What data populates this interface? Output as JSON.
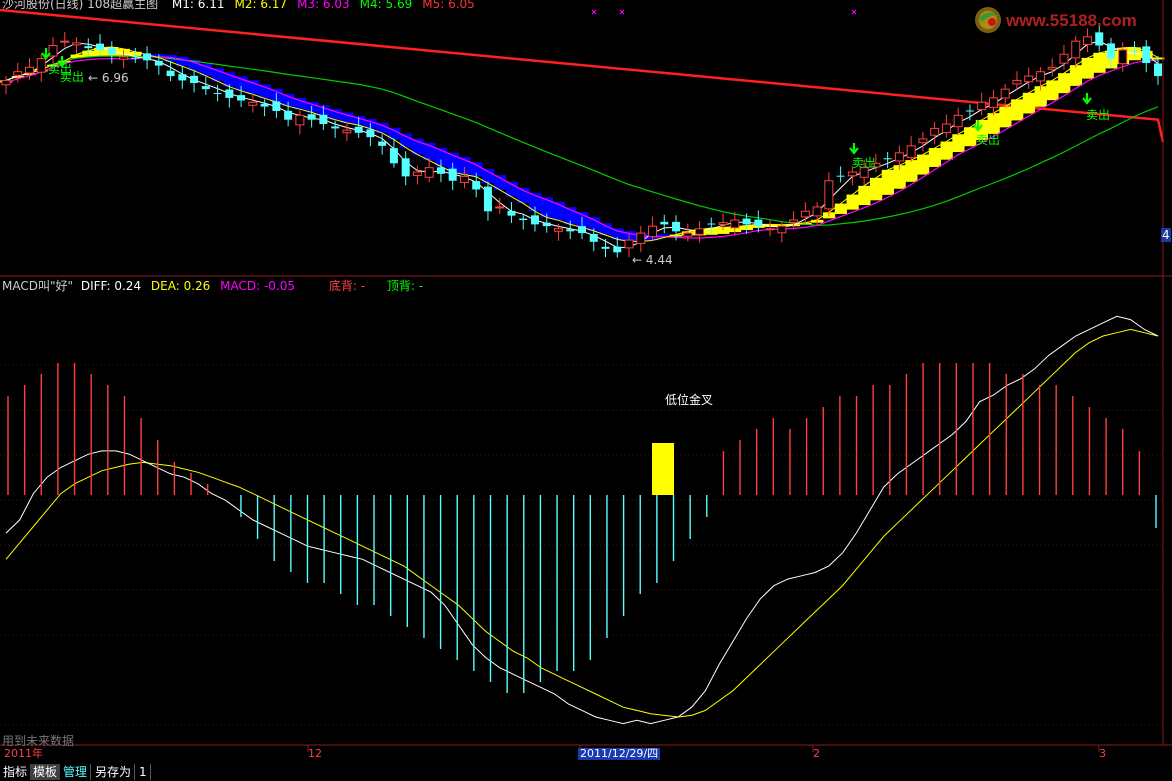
{
  "title_bar": {
    "name": "沙河股份(日线) 108超赢主图",
    "ma_labels": [
      {
        "text": "M1: 6.11",
        "color": "#ffffff"
      },
      {
        "text": "M2: 6.17",
        "color": "#ffff00"
      },
      {
        "text": "M3: 6.03",
        "color": "#ff00ff"
      },
      {
        "text": "M4: 5.69",
        "color": "#00ff00"
      },
      {
        "text": "M5: 6.05",
        "color": "#ff3030"
      }
    ]
  },
  "watermark": {
    "text": "www.55188.com"
  },
  "price_panel": {
    "high_label": "6.96",
    "low_label": "4.44",
    "sell_label": "卖出",
    "right_edge_label": "4"
  },
  "macd_panel": {
    "name": "MACD叫\"好\"",
    "diff_label": "DIFF: 0.24",
    "dea_label": "DEA: 0.26",
    "macd_label": "MACD: -0.05",
    "bottom_div": "底背: -",
    "top_div": "顶背: -",
    "annotation": "低位金叉",
    "bottom_note": "用到未来数据"
  },
  "x_axis": {
    "labels": [
      "2011年",
      "12",
      "2011/12/29/四",
      "2",
      "3"
    ]
  },
  "tabs": [
    "指标",
    "模板",
    "管理",
    "另存为",
    "1"
  ],
  "colors": {
    "up": "#ff4040",
    "down": "#54ffff",
    "diff": "#ffffff",
    "dea": "#ffff00",
    "macd_pos": "#ff4040",
    "macd_neg": "#54ffff",
    "ma_long": "#ff2020",
    "ma_mid": "#00cc00",
    "ma_short": "#ff00ff",
    "band_up": "#ffff00",
    "band_down": "#0000ff",
    "sell_arrow": "#00ff00"
  },
  "chart_data": [
    {
      "type": "candlestick",
      "title": "沙河股份(日线) 108超赢主图",
      "ylim": [
        4.3,
        7.2
      ],
      "annotations": [
        {
          "text": "6.96",
          "kind": "high"
        },
        {
          "text": "4.44",
          "kind": "low"
        }
      ],
      "series": [
        {
          "name": "M1",
          "last": 6.11
        },
        {
          "name": "M2",
          "last": 6.17
        },
        {
          "name": "M3",
          "last": 6.03
        },
        {
          "name": "M4",
          "last": 5.69
        },
        {
          "name": "M5",
          "last": 6.05
        }
      ],
      "close": [
        6.45,
        6.55,
        6.6,
        6.7,
        6.85,
        6.9,
        6.88,
        6.82,
        6.8,
        6.75,
        6.72,
        6.7,
        6.68,
        6.62,
        6.5,
        6.45,
        6.42,
        6.35,
        6.3,
        6.25,
        6.22,
        6.2,
        6.15,
        6.1,
        6.0,
        6.05,
        6.0,
        5.95,
        5.9,
        5.88,
        5.85,
        5.8,
        5.7,
        5.5,
        5.35,
        5.4,
        5.45,
        5.38,
        5.3,
        5.35,
        5.2,
        4.95,
        5.0,
        4.9,
        4.85,
        4.8,
        4.78,
        4.75,
        4.72,
        4.7,
        4.6,
        4.52,
        4.48,
        4.62,
        4.7,
        4.78,
        4.8,
        4.72,
        4.7,
        4.75,
        4.8,
        4.82,
        4.85,
        4.8,
        4.78,
        4.75,
        4.78,
        4.85,
        4.95,
        5.0,
        5.3,
        5.35,
        5.4,
        5.45,
        5.5,
        5.55,
        5.62,
        5.7,
        5.78,
        5.9,
        5.95,
        6.05,
        6.1,
        6.2,
        6.25,
        6.35,
        6.45,
        6.5,
        6.55,
        6.6,
        6.75,
        6.9,
        6.95,
        6.85,
        6.7,
        6.8,
        6.78,
        6.65,
        6.5
      ]
    },
    {
      "type": "line",
      "title": "MACD叫\"好\"",
      "last": {
        "DIFF": 0.24,
        "DEA": 0.26,
        "MACD": -0.05
      },
      "series": [
        {
          "name": "DIFF",
          "values": [
            -0.12,
            -0.08,
            0.0,
            0.05,
            0.08,
            0.1,
            0.12,
            0.13,
            0.13,
            0.12,
            0.1,
            0.08,
            0.06,
            0.05,
            0.03,
            0.0,
            -0.02,
            -0.05,
            -0.08,
            -0.1,
            -0.12,
            -0.14,
            -0.16,
            -0.17,
            -0.18,
            -0.19,
            -0.2,
            -0.22,
            -0.24,
            -0.26,
            -0.28,
            -0.3,
            -0.34,
            -0.4,
            -0.46,
            -0.5,
            -0.53,
            -0.55,
            -0.57,
            -0.59,
            -0.61,
            -0.64,
            -0.66,
            -0.68,
            -0.69,
            -0.7,
            -0.69,
            -0.7,
            -0.69,
            -0.68,
            -0.65,
            -0.6,
            -0.52,
            -0.45,
            -0.38,
            -0.32,
            -0.28,
            -0.26,
            -0.25,
            -0.24,
            -0.22,
            -0.18,
            -0.12,
            -0.05,
            0.02,
            0.06,
            0.09,
            0.12,
            0.15,
            0.18,
            0.22,
            0.28,
            0.3,
            0.33,
            0.35,
            0.38,
            0.42,
            0.45,
            0.48,
            0.5,
            0.52,
            0.54,
            0.53,
            0.5,
            0.48
          ]
        },
        {
          "name": "DEA",
          "values": [
            -0.2,
            -0.15,
            -0.1,
            -0.05,
            0.0,
            0.03,
            0.05,
            0.07,
            0.08,
            0.09,
            0.095,
            0.09,
            0.085,
            0.075,
            0.065,
            0.05,
            0.035,
            0.02,
            0.0,
            -0.02,
            -0.04,
            -0.06,
            -0.08,
            -0.1,
            -0.12,
            -0.14,
            -0.16,
            -0.18,
            -0.2,
            -0.22,
            -0.25,
            -0.28,
            -0.31,
            -0.34,
            -0.38,
            -0.42,
            -0.45,
            -0.48,
            -0.5,
            -0.53,
            -0.55,
            -0.57,
            -0.59,
            -0.61,
            -0.63,
            -0.65,
            -0.66,
            -0.67,
            -0.675,
            -0.68,
            -0.675,
            -0.66,
            -0.63,
            -0.6,
            -0.56,
            -0.52,
            -0.48,
            -0.44,
            -0.4,
            -0.36,
            -0.32,
            -0.28,
            -0.23,
            -0.18,
            -0.13,
            -0.09,
            -0.05,
            -0.01,
            0.03,
            0.07,
            0.11,
            0.15,
            0.19,
            0.23,
            0.27,
            0.31,
            0.35,
            0.39,
            0.43,
            0.46,
            0.48,
            0.49,
            0.5,
            0.49,
            0.48
          ]
        },
        {
          "name": "MACD",
          "values": [
            0.09,
            0.1,
            0.11,
            0.12,
            0.12,
            0.11,
            0.1,
            0.09,
            0.07,
            0.05,
            0.03,
            0.02,
            0.01,
            0.0,
            -0.02,
            -0.04,
            -0.06,
            -0.07,
            -0.08,
            -0.08,
            -0.09,
            -0.1,
            -0.1,
            -0.11,
            -0.12,
            -0.13,
            -0.14,
            -0.15,
            -0.16,
            -0.17,
            -0.18,
            -0.18,
            -0.17,
            -0.16,
            -0.16,
            -0.15,
            -0.13,
            -0.11,
            -0.09,
            -0.08,
            -0.06,
            -0.04,
            -0.02,
            0.04,
            0.05,
            0.06,
            0.07,
            0.06,
            0.07,
            0.08,
            0.09,
            0.09,
            0.1,
            0.1,
            0.11,
            0.12,
            0.12,
            0.12,
            0.12,
            0.12,
            0.11,
            0.11,
            0.1,
            0.1,
            0.09,
            0.08,
            0.07,
            0.06,
            0.04,
            -0.03
          ]
        }
      ]
    }
  ]
}
